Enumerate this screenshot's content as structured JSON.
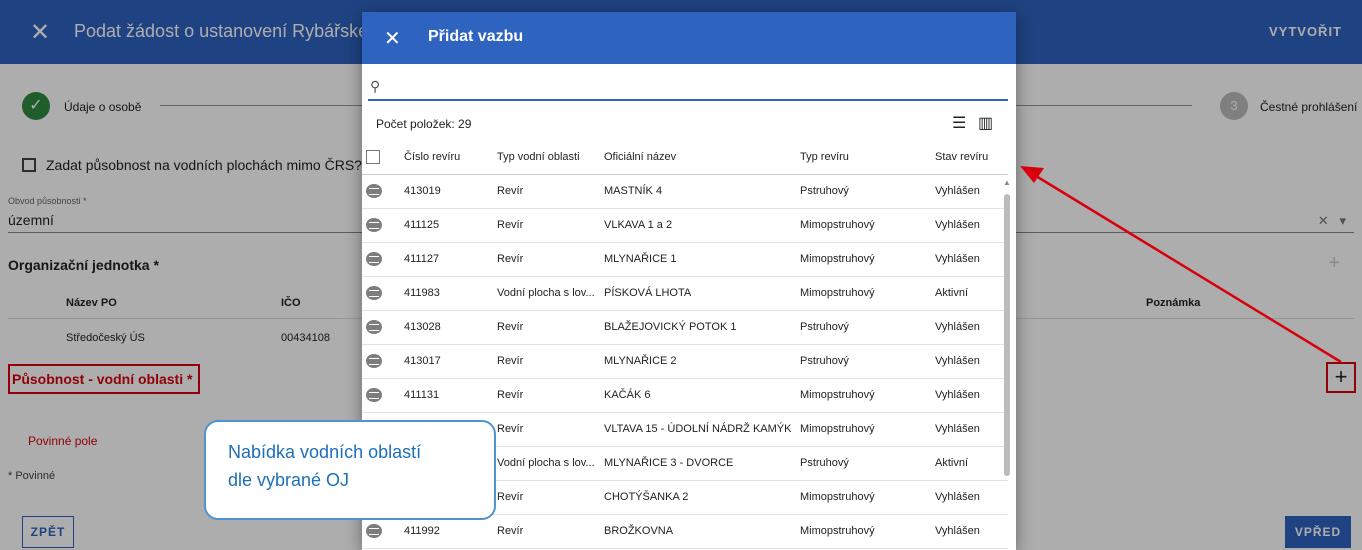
{
  "page": {
    "title": "Podat žádost o ustanovení Rybářské st",
    "create_label": "VYTVOŘIT",
    "steps": [
      {
        "label": "Údaje o osobě",
        "state": "done"
      },
      {
        "label": "Čestné prohlášení",
        "number": "3"
      }
    ],
    "checkbox_label": "Zadat působnost na vodních plochách mimo ČRS?",
    "obvod": {
      "label": "Obvod působnosti *",
      "value": "územní"
    },
    "oj": {
      "title": "Organizační jednotka *",
      "columns": [
        "Název PO",
        "IČO",
        "Poznámka"
      ],
      "row": {
        "nazev": "Středočeský ÚS",
        "ico": "00434108"
      }
    },
    "pv_title": "Působnost - vodní oblasti *",
    "povinne_pole": "Povinné pole",
    "povinne": "* Povinné",
    "back_label": "ZPĚT",
    "next_label": "VPŘED"
  },
  "modal": {
    "title": "Přidat vazbu",
    "search_value": "",
    "count_text": "Počet položek: 29",
    "columns": [
      "Číslo revíru",
      "Typ vodní oblasti",
      "Oficiální název",
      "Typ revíru",
      "Stav revíru"
    ],
    "rows": [
      [
        "413019",
        "Revír",
        "MASTNÍK 4",
        "Pstruhový",
        "Vyhlášen"
      ],
      [
        "411125",
        "Revír",
        "VLKAVA 1 a 2",
        "Mimopstruhový",
        "Vyhlášen"
      ],
      [
        "411127",
        "Revír",
        "MLYNAŘICE 1",
        "Mimopstruhový",
        "Vyhlášen"
      ],
      [
        "411983",
        "Vodní plocha s lov...",
        "PÍSKOVÁ LHOTA",
        "Mimopstruhový",
        "Aktivní"
      ],
      [
        "413028",
        "Revír",
        "BLAŽEJOVICKÝ POTOK 1",
        "Pstruhový",
        "Vyhlášen"
      ],
      [
        "413017",
        "Revír",
        "MLYNAŘICE 2",
        "Pstruhový",
        "Vyhlášen"
      ],
      [
        "411131",
        "Revír",
        "KAČÁK 6",
        "Mimopstruhový",
        "Vyhlášen"
      ],
      [
        "",
        "Revír",
        "VLTAVA 15 - ÚDOLNÍ NÁDRŽ KAMÝK",
        "Mimopstruhový",
        "Vyhlášen"
      ],
      [
        "",
        "Vodní plocha s lov...",
        "MLYNAŘICE 3 - DVORCE",
        "Pstruhový",
        "Aktivní"
      ],
      [
        "",
        "Revír",
        "CHOTÝŠANKA 2",
        "Mimopstruhový",
        "Vyhlášen"
      ],
      [
        "411992",
        "Revír",
        "BROŽKOVNA",
        "Mimopstruhový",
        "Vyhlášen"
      ]
    ]
  },
  "callout": {
    "line1": "Nabídka vodních oblastí",
    "line2": "dle vybrané OJ"
  },
  "colors": {
    "primary": "#2f63c0",
    "annotation_red": "#d9000d",
    "callout_blue": "#4f93d0"
  }
}
